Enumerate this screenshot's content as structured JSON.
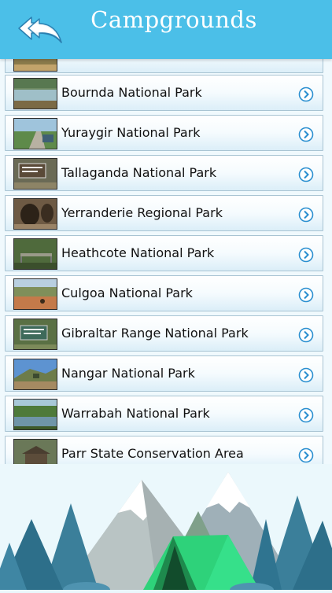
{
  "header": {
    "title": "Campgrounds",
    "back_icon": "back-arrows-icon"
  },
  "list": {
    "items": [
      {
        "label": "Bournda National Park",
        "thumb": "lake-photo"
      },
      {
        "label": "Yuraygir National Park",
        "thumb": "road-photo"
      },
      {
        "label": "Tallaganda National Park",
        "thumb": "sign-photo"
      },
      {
        "label": "Yerranderie Regional Park",
        "thumb": "cave-photo"
      },
      {
        "label": "Heathcote National Park",
        "thumb": "bridge-photo"
      },
      {
        "label": "Culgoa National Park",
        "thumb": "red-soil-photo"
      },
      {
        "label": "Gibraltar Range National Park",
        "thumb": "signboard-photo"
      },
      {
        "label": "Nangar National Park",
        "thumb": "hill-photo"
      },
      {
        "label": "Warrabah National Park",
        "thumb": "river-photo"
      },
      {
        "label": "Parr State Conservation Area",
        "thumb": "shelter-photo"
      }
    ],
    "chevron_icon": "chevron-right-circle-icon"
  },
  "colors": {
    "header": "#4bbfe8",
    "chevron": "#2a8fd0",
    "tent": "#2ed27a"
  }
}
